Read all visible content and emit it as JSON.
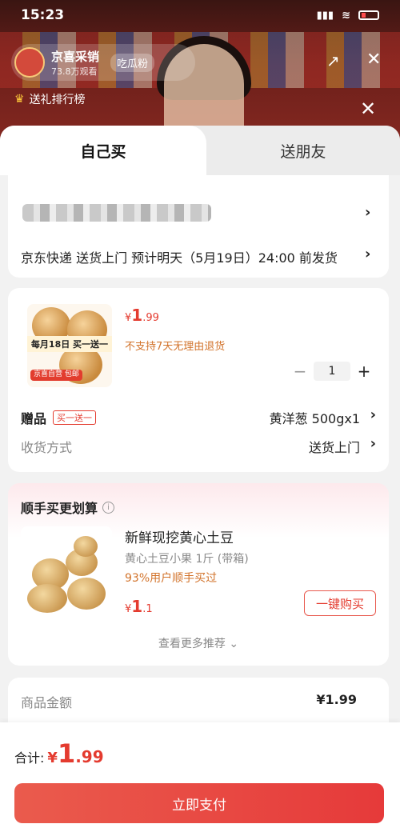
{
  "status_bar": {
    "time": "15:23"
  },
  "live": {
    "host_name": "京喜采销",
    "viewers": "73.8万观看",
    "host_tag": "吃瓜粉",
    "rank_label": "送礼排行榜"
  },
  "tabs": [
    {
      "label": "自己买",
      "active": true
    },
    {
      "label": "送朋友",
      "active": false
    }
  ],
  "address": {
    "delivery": "京东快递 送货上门 预计明天（5月19日）24:00 前发货"
  },
  "product": {
    "image_promo": "每月18日 买一送一",
    "image_badge": "京喜自营 包邮",
    "price_currency": "¥",
    "price_int": "1",
    "price_dec": ".99",
    "return_note": "不支持7天无理由退货",
    "quantity": "1",
    "gift_label": "赠品",
    "gift_tag": "买一送一",
    "gift_value": "黄洋葱 500gx1",
    "receive_label": "收货方式",
    "receive_value": "送货上门"
  },
  "recommend": {
    "title": "顺手买更划算",
    "name": "新鲜现挖黄心土豆",
    "spec": "黄心土豆小果 1斤 (带箱)",
    "bought": "93%用户顺手买过",
    "price_currency": "¥",
    "price_int": "1",
    "price_dec": ".1",
    "buy_label": "一键购买",
    "more_label": "查看更多推荐"
  },
  "amount": {
    "label": "商品金额",
    "value": "¥1.99"
  },
  "footer": {
    "total_label": "合计:",
    "currency": "¥",
    "total_int": "1",
    "total_dec": ".99",
    "pay_label": "立即支付"
  },
  "colors": {
    "accent": "#e43b2f",
    "orange_note": "#d2732b"
  }
}
